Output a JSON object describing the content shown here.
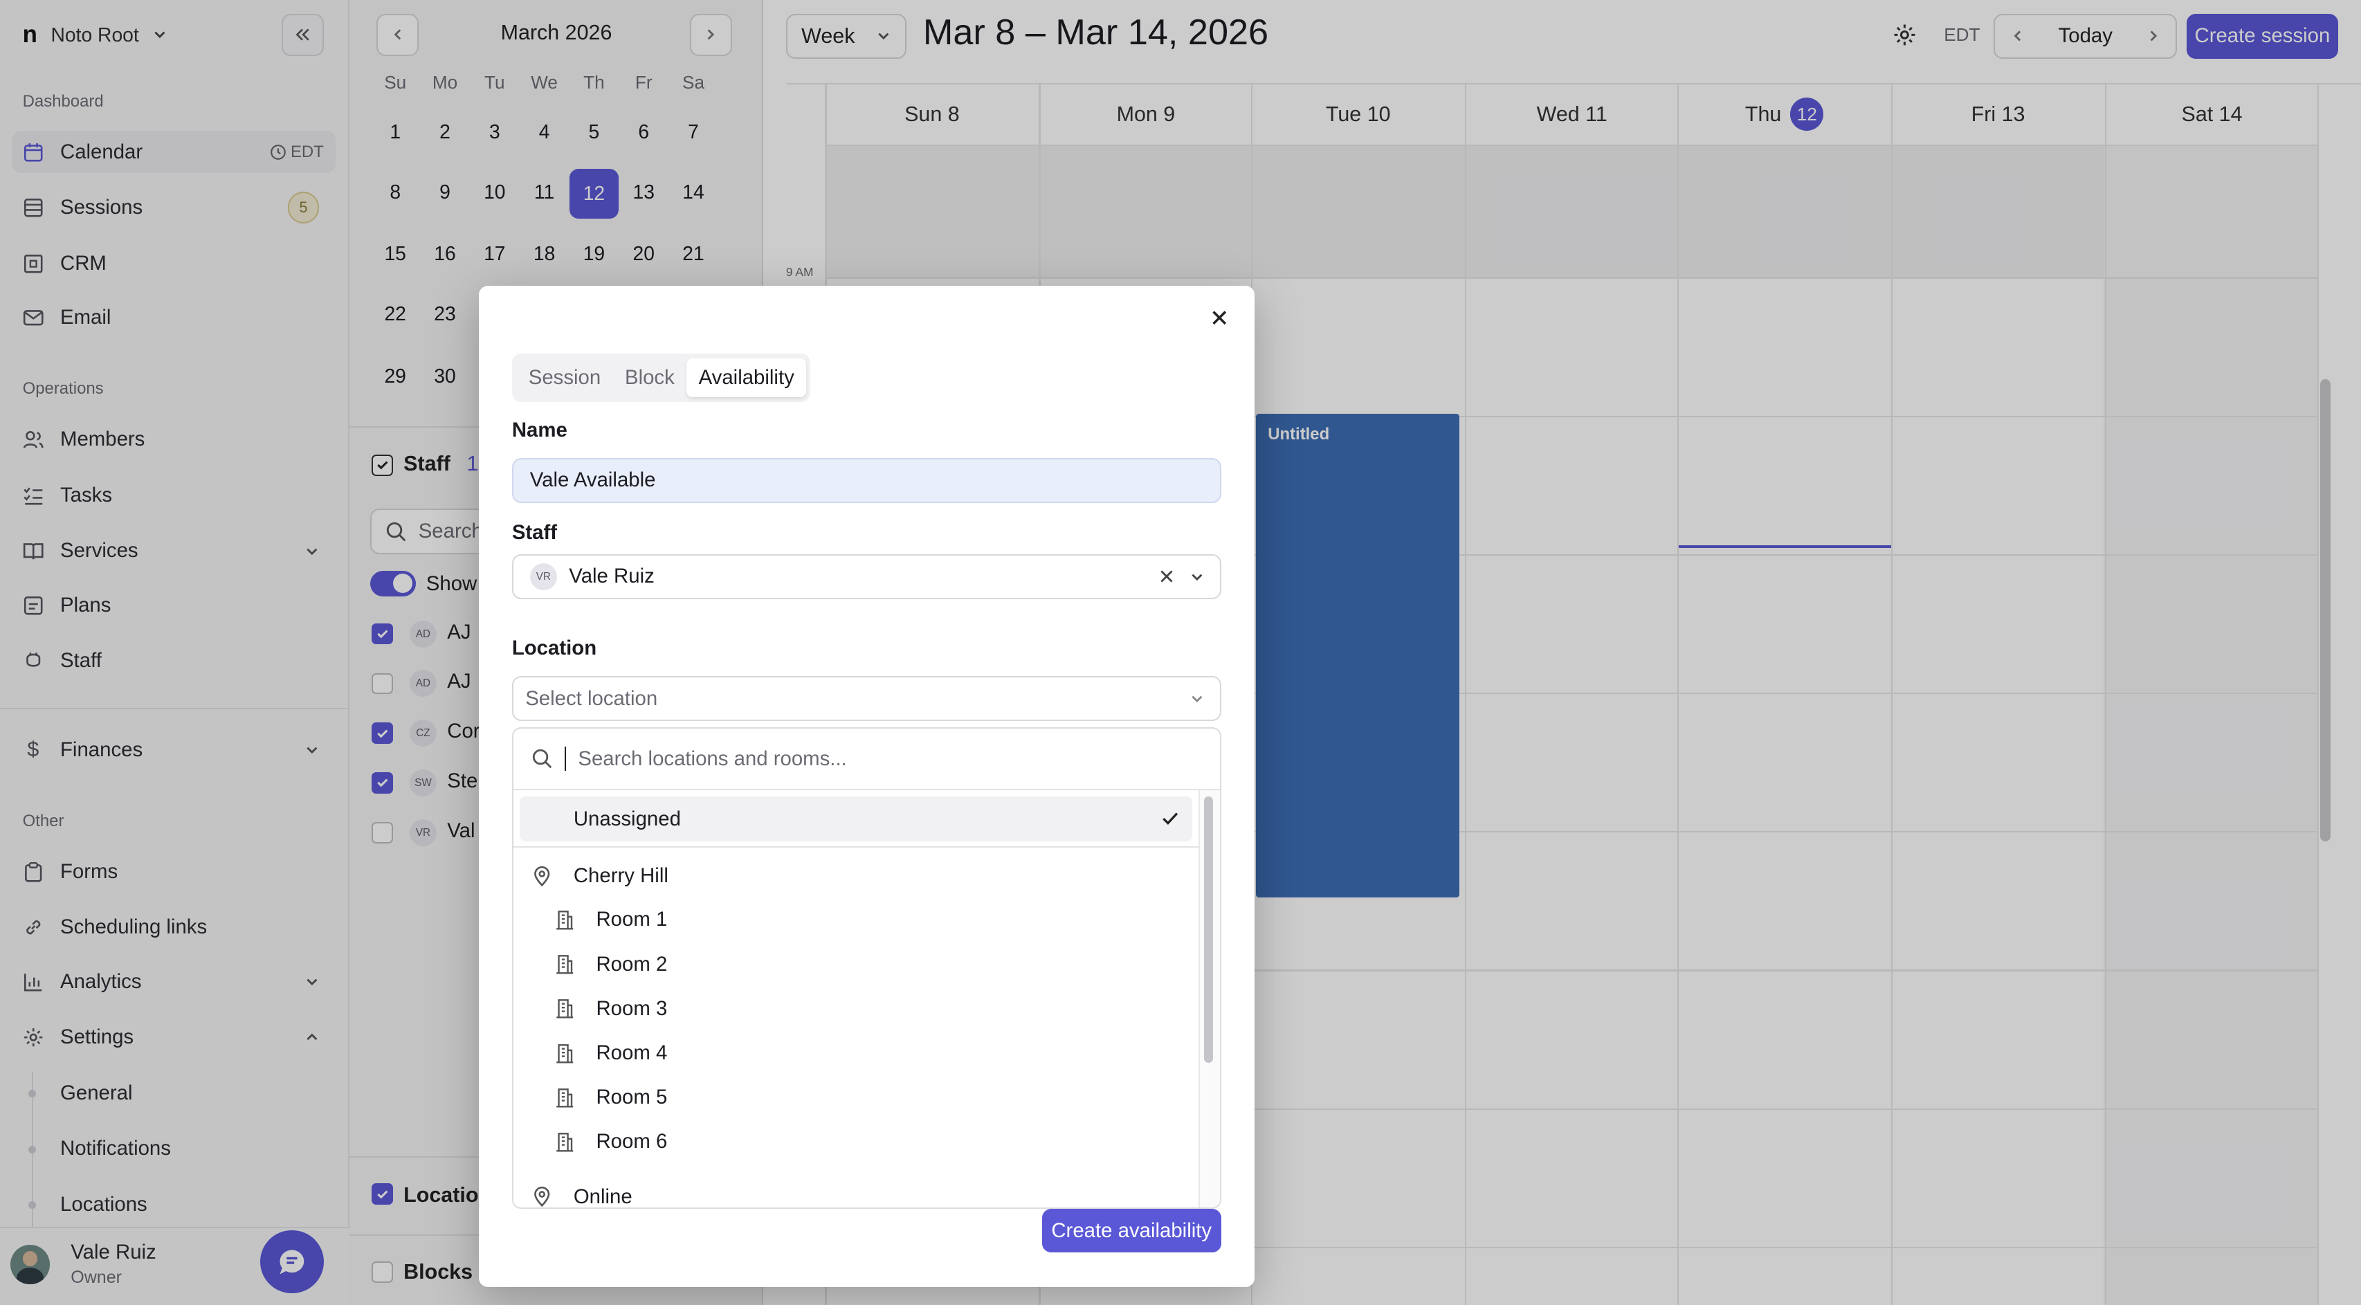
{
  "sidebar": {
    "org_name": "Noto Root",
    "sections": {
      "dashboard": "Dashboard",
      "operations": "Operations",
      "other": "Other"
    },
    "items": {
      "calendar": {
        "label": "Calendar",
        "tz": "EDT"
      },
      "sessions": {
        "label": "Sessions",
        "badge": "5"
      },
      "crm": {
        "label": "CRM"
      },
      "email": {
        "label": "Email"
      },
      "members": {
        "label": "Members"
      },
      "tasks": {
        "label": "Tasks"
      },
      "services": {
        "label": "Services"
      },
      "plans": {
        "label": "Plans"
      },
      "staff": {
        "label": "Staff"
      },
      "finances": {
        "label": "Finances"
      },
      "forms": {
        "label": "Forms"
      },
      "scheduling": {
        "label": "Scheduling links"
      },
      "analytics": {
        "label": "Analytics"
      },
      "settings": {
        "label": "Settings"
      }
    },
    "settings_sub": [
      "General",
      "Notifications",
      "Locations"
    ],
    "user": {
      "name": "Vale Ruiz",
      "role": "Owner"
    }
  },
  "mini_calendar": {
    "month": "March 2026",
    "dows": [
      "Su",
      "Mo",
      "Tu",
      "We",
      "Th",
      "Fr",
      "Sa"
    ],
    "weeks": [
      [
        "1",
        "2",
        "3",
        "4",
        "5",
        "6",
        "7"
      ],
      [
        "8",
        "9",
        "10",
        "11",
        "12",
        "13",
        "14"
      ],
      [
        "15",
        "16",
        "17",
        "18",
        "19",
        "20",
        "21"
      ],
      [
        "22",
        "23"
      ],
      [
        "29",
        "30"
      ]
    ],
    "selected": "12"
  },
  "filters": {
    "staff_label": "Staff",
    "staff_count": "1",
    "search_placeholder": "Search",
    "show_label": "Show",
    "staff_rows": [
      {
        "initials": "AD",
        "name": "AJ",
        "checked": true
      },
      {
        "initials": "AD",
        "name": "AJ",
        "checked": false
      },
      {
        "initials": "CZ",
        "name": "Cor",
        "checked": true
      },
      {
        "initials": "SW",
        "name": "Ste",
        "checked": true
      },
      {
        "initials": "VR",
        "name": "Val",
        "checked": false
      }
    ],
    "locations_label": "Location",
    "blocks_label": "Blocks"
  },
  "header": {
    "view": "Week",
    "range": "Mar 8 – Mar 14, 2026",
    "tz": "EDT",
    "today": "Today",
    "create": "Create session"
  },
  "week": {
    "days": [
      "Sun 8",
      "Mon 9",
      "Tue 10",
      "Wed 11",
      "Thu",
      "Fri 13",
      "Sat 14"
    ],
    "today_num": "12",
    "time_label": "9 AM",
    "event_title": "Untitled"
  },
  "modal": {
    "tabs": [
      "Session",
      "Block",
      "Availability"
    ],
    "active_tab": "Availability",
    "name_label": "Name",
    "name_value": "Vale Available",
    "staff_label": "Staff",
    "staff_initials": "VR",
    "staff_value": "Vale Ruiz",
    "location_label": "Location",
    "location_placeholder": "Select location",
    "search_placeholder": "Search locations and rooms...",
    "options": {
      "unassigned": "Unassigned",
      "cherry_hill": "Cherry Hill",
      "rooms": [
        "Room 1",
        "Room 2",
        "Room 3",
        "Room 4",
        "Room 5",
        "Room 6"
      ],
      "online": "Online"
    },
    "submit": "Create availability"
  },
  "colors": {
    "accent": "#5a58d6",
    "event": "#3d6db5",
    "overlay": "rgba(0,0,0,0.2)"
  }
}
